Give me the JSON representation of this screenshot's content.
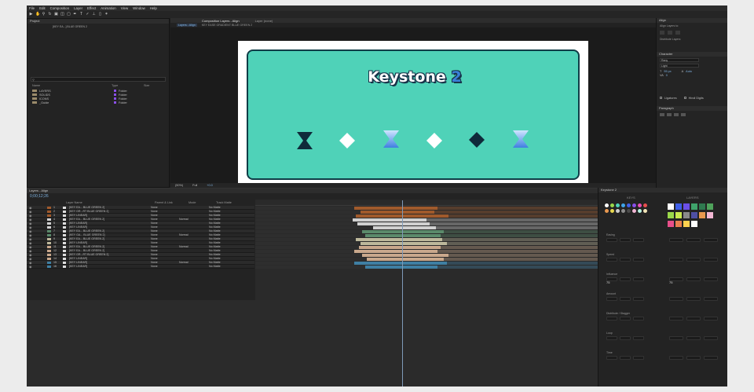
{
  "menu": [
    "File",
    "Edit",
    "Composition",
    "Layer",
    "Effect",
    "Animation",
    "View",
    "Window",
    "Help"
  ],
  "project": {
    "tab": "Project",
    "preview_name": "[KEY EA...] BLUE GREEN 2",
    "search_placeholder": "",
    "columns": [
      "Name",
      "Type",
      "Size"
    ],
    "items": [
      {
        "name": "LAYERS",
        "type": "Folder"
      },
      {
        "name": "SOLIDS",
        "type": "Folder"
      },
      {
        "name": "ICONS",
        "type": "Folder"
      },
      {
        "name": "_Guide",
        "type": "Folder"
      }
    ]
  },
  "composition": {
    "tabs": [
      "Composition Layers - Align",
      "Layer (none)"
    ],
    "sub_tabs": [
      "Layers - Align",
      "KEY EASE GRADIENT BLUE GREEN 2"
    ],
    "zoom": "(50%)",
    "quality": "Full",
    "exposure": "+0.0"
  },
  "canvas_content": {
    "title": "Keystone",
    "title_number": "2"
  },
  "align_panel": {
    "tab": "Align",
    "align_to": "Align Layers to:",
    "distribute": "Distribute Layers:"
  },
  "character_panel": {
    "tab": "Character",
    "font": "Rany",
    "style": "Light",
    "size": "55 px",
    "leading": "Auto",
    "tracking": "0",
    "ligatures": "Ligatures",
    "hindi": "Hindi Digits"
  },
  "paragraph_panel": {
    "tab": "Paragraph"
  },
  "timeline": {
    "tab": "Layers - Align",
    "timecode": "0;00;12;26",
    "columns": [
      "Layer Name",
      "Parent & Link",
      "Mode",
      "Track Matte"
    ],
    "layers": [
      {
        "num": "1",
        "name": "[KEY EA... BLUE GREEN 2]",
        "color": "#a05a2c",
        "parent": "None",
        "mode": "",
        "matte": "No Matte"
      },
      {
        "num": "2",
        "name": "[KEY GR...RT BLUE GREEN 2]",
        "color": "#a05a2c",
        "parent": "None",
        "mode": "",
        "matte": "No Matte"
      },
      {
        "num": "3",
        "name": "[KEY LINEAR]",
        "color": "#a05a2c",
        "parent": "None",
        "mode": "",
        "matte": "No Matte"
      },
      {
        "num": "4",
        "name": "[KEY EA... BLUE GREEN 2]",
        "color": "#d0d0d0",
        "parent": "None",
        "mode": "Normal",
        "matte": "No Matte"
      },
      {
        "num": "5",
        "name": "[KEY LINEAR]",
        "color": "#d0d0d0",
        "parent": "None",
        "mode": "",
        "matte": "No Matte"
      },
      {
        "num": "6",
        "name": "[KEY LINEAR]",
        "color": "#d0d0d0",
        "parent": "None",
        "mode": "",
        "matte": "No Matte"
      },
      {
        "num": "7",
        "name": "[KEY EA... BLUE GREEN 2]",
        "color": "#5b8a6b",
        "parent": "None",
        "mode": "",
        "matte": "No Matte"
      },
      {
        "num": "8",
        "name": "[KEY GA... BLUE GREEN 2]",
        "color": "#5b8a6b",
        "parent": "None",
        "mode": "Normal",
        "matte": "No Matte"
      },
      {
        "num": "9",
        "name": "[KEY EA... BLUE GREEN 2]",
        "color": "#bdb89b",
        "parent": "None",
        "mode": "",
        "matte": "No Matte"
      },
      {
        "num": "10",
        "name": "[KEY LINEAR]",
        "color": "#bdb89b",
        "parent": "None",
        "mode": "",
        "matte": "No Matte"
      },
      {
        "num": "11",
        "name": "[KEY EA... BLUE GREEN 2]",
        "color": "#c9a88c",
        "parent": "None",
        "mode": "Normal",
        "matte": "No Matte"
      },
      {
        "num": "12",
        "name": "[KEY EA... BLUE GREEN 2]",
        "color": "#c9a88c",
        "parent": "None",
        "mode": "",
        "matte": "No Matte"
      },
      {
        "num": "13",
        "name": "[KEY GR...RT BLUE GREEN 2]",
        "color": "#c9a88c",
        "parent": "None",
        "mode": "",
        "matte": "No Matte"
      },
      {
        "num": "14",
        "name": "[KEY LINEAR]",
        "color": "#c9a88c",
        "parent": "None",
        "mode": "",
        "matte": "No Matte"
      },
      {
        "num": "15",
        "name": "[KEY LINEAR]",
        "color": "#3f7fa3",
        "parent": "None",
        "mode": "Normal",
        "matte": "No Matte"
      },
      {
        "num": "16",
        "name": "[KEY LINEAR]",
        "color": "#3f7fa3",
        "parent": "None",
        "mode": "",
        "matte": "No Matte"
      }
    ]
  },
  "keystone": {
    "tab": "Keystone 2",
    "left_tab": "KEYS",
    "right_tab": "LAYERS",
    "swatch_colors": [
      "#ffffff",
      "#9ad84a",
      "#4fd2b8",
      "#3fa3e8",
      "#3f5fe8",
      "#8a4fe8",
      "#e84fb8",
      "#e84f4f",
      "#e8984f",
      "#e8d84f",
      "#cfcfcf",
      "#8f8f8f",
      "#4a4a4a",
      "#f2b7d4",
      "#b7f2e0",
      "#f2e4b7"
    ],
    "layer_colors": [
      "#ffffff",
      "#3f5fe8",
      "#6b4fe8",
      "#3fa36b",
      "#2f7a4f",
      "#4fa35b",
      "#9ad84a",
      "#c9e84f",
      "#8a8a8a",
      "#4f4fa3",
      "#e8984f",
      "#f2b7d4",
      "#e84f8a",
      "#e87f4f",
      "#ffd24f",
      "#ffffff"
    ],
    "sections": [
      "Easing",
      "Speed",
      "Influence",
      "Amount",
      "Distribute / Stagger",
      "Loop",
      "Time"
    ],
    "values": {
      "influence": "75",
      "amount": "75"
    }
  }
}
